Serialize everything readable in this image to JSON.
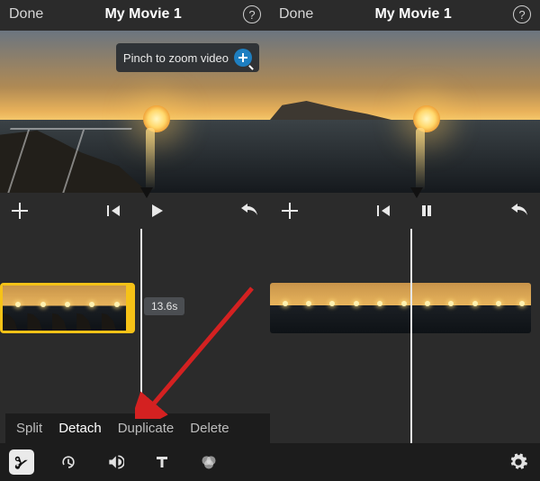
{
  "left": {
    "header": {
      "done": "Done",
      "title": "My Movie 1",
      "help": "?"
    },
    "tooltip": {
      "label": "Pinch to zoom video"
    },
    "duration": "13.6s",
    "actions": {
      "split": "Split",
      "detach": "Detach",
      "duplicate": "Duplicate",
      "delete": "Delete"
    }
  },
  "right": {
    "header": {
      "done": "Done",
      "title": "My Movie 1",
      "help": "?"
    }
  }
}
